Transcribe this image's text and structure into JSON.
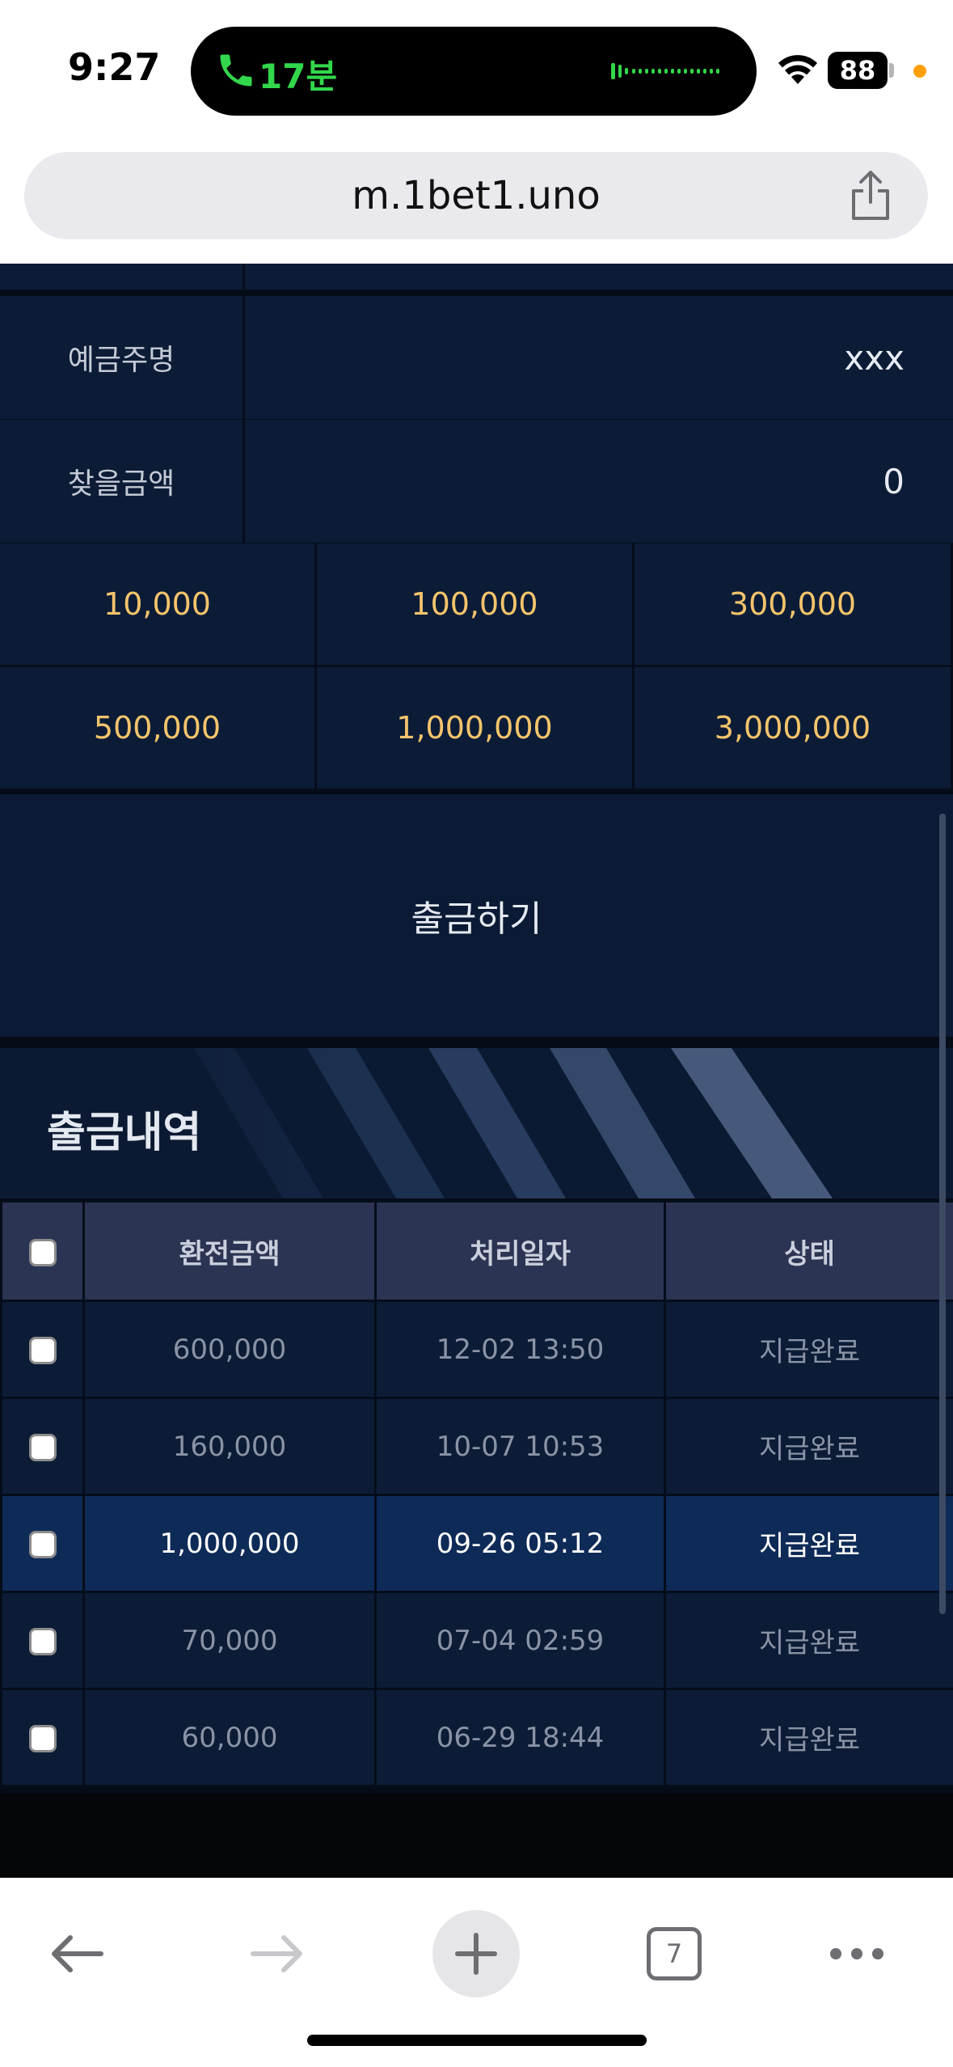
{
  "status_bar": {
    "time": "9:27",
    "call_duration": "17분",
    "battery": "88",
    "icons": [
      "phone-icon",
      "waveform-icon",
      "wifi-icon",
      "battery-icon"
    ]
  },
  "browser": {
    "url": "m.1bet1.uno",
    "tab_count": "7",
    "icons": [
      "share-icon",
      "back-arrow-icon",
      "forward-arrow-icon",
      "plus-icon",
      "tabs-icon",
      "more-icon"
    ]
  },
  "form": {
    "account_holder_label": "예금주명",
    "account_holder_value": "xxx",
    "withdraw_amount_label": "찾을금액",
    "withdraw_amount_value": "0"
  },
  "amount_buttons": [
    "10,000",
    "100,000",
    "300,000",
    "500,000",
    "1,000,000",
    "3,000,000"
  ],
  "withdraw_button_label": "출금하기",
  "history": {
    "title": "출금내역",
    "columns": [
      "환전금액",
      "처리일자",
      "상태"
    ],
    "rows": [
      {
        "amount": "600,000",
        "date": "12-02 13:50",
        "status": "지급완료"
      },
      {
        "amount": "160,000",
        "date": "10-07 10:53",
        "status": "지급완료"
      },
      {
        "amount": "1,000,000",
        "date": "09-26 05:12",
        "status": "지급완료"
      },
      {
        "amount": "70,000",
        "date": "07-04 02:59",
        "status": "지급완료"
      },
      {
        "amount": "60,000",
        "date": "06-29 18:44",
        "status": "지급완료"
      }
    ],
    "highlighted_row": 2
  },
  "colors": {
    "page_bg": "#050b17",
    "row_bg": "#0c1c36",
    "amount_gold": "#f4c46c",
    "table_header_bg": "#2b3452",
    "highlight_row_bg": "#0e2a57",
    "call_green": "#32d74b"
  }
}
